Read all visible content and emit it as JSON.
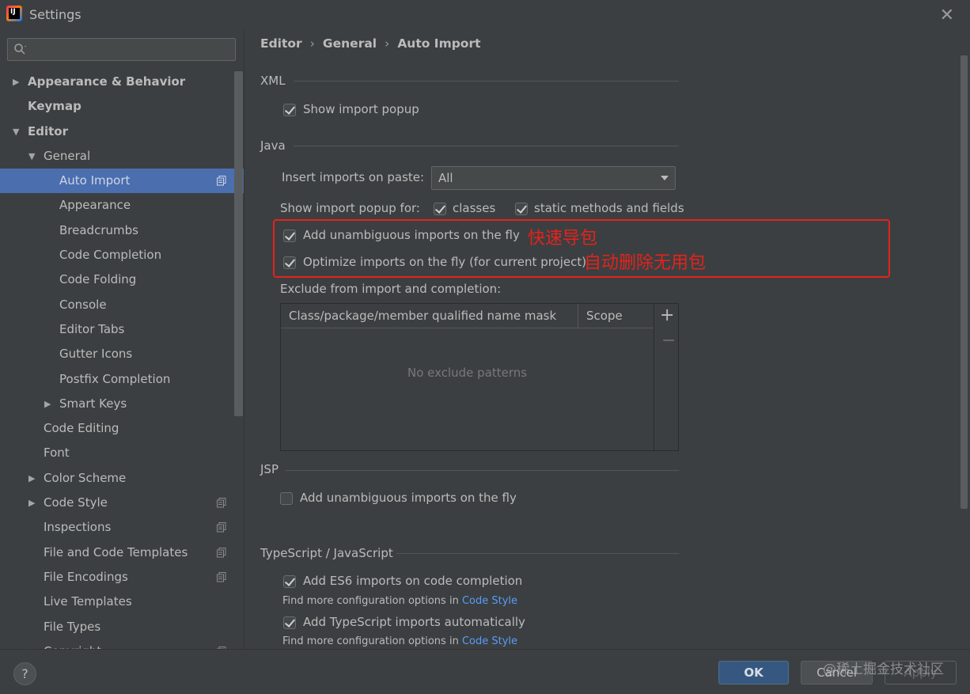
{
  "window": {
    "title": "Settings"
  },
  "search": {
    "placeholder": ""
  },
  "sidebar": {
    "items": [
      {
        "label": "Appearance & Behavior",
        "depth": 0,
        "bold": true,
        "arrow": "right"
      },
      {
        "label": "Keymap",
        "depth": 0,
        "bold": true,
        "arrow": ""
      },
      {
        "label": "Editor",
        "depth": 0,
        "bold": true,
        "arrow": "down"
      },
      {
        "label": "General",
        "depth": 1,
        "bold": false,
        "arrow": "down"
      },
      {
        "label": "Auto Import",
        "depth": 2,
        "bold": false,
        "arrow": "",
        "selected": true,
        "copy": true
      },
      {
        "label": "Appearance",
        "depth": 2,
        "bold": false,
        "arrow": ""
      },
      {
        "label": "Breadcrumbs",
        "depth": 2,
        "bold": false,
        "arrow": ""
      },
      {
        "label": "Code Completion",
        "depth": 2,
        "bold": false,
        "arrow": ""
      },
      {
        "label": "Code Folding",
        "depth": 2,
        "bold": false,
        "arrow": ""
      },
      {
        "label": "Console",
        "depth": 2,
        "bold": false,
        "arrow": ""
      },
      {
        "label": "Editor Tabs",
        "depth": 2,
        "bold": false,
        "arrow": ""
      },
      {
        "label": "Gutter Icons",
        "depth": 2,
        "bold": false,
        "arrow": ""
      },
      {
        "label": "Postfix Completion",
        "depth": 2,
        "bold": false,
        "arrow": ""
      },
      {
        "label": "Smart Keys",
        "depth": 2,
        "bold": false,
        "arrow": "right"
      },
      {
        "label": "Code Editing",
        "depth": 1,
        "bold": false,
        "arrow": ""
      },
      {
        "label": "Font",
        "depth": 1,
        "bold": false,
        "arrow": ""
      },
      {
        "label": "Color Scheme",
        "depth": 1,
        "bold": false,
        "arrow": "right"
      },
      {
        "label": "Code Style",
        "depth": 1,
        "bold": false,
        "arrow": "right",
        "copy": true
      },
      {
        "label": "Inspections",
        "depth": 1,
        "bold": false,
        "arrow": "",
        "copy": true
      },
      {
        "label": "File and Code Templates",
        "depth": 1,
        "bold": false,
        "arrow": "",
        "copy": true
      },
      {
        "label": "File Encodings",
        "depth": 1,
        "bold": false,
        "arrow": "",
        "copy": true
      },
      {
        "label": "Live Templates",
        "depth": 1,
        "bold": false,
        "arrow": ""
      },
      {
        "label": "File Types",
        "depth": 1,
        "bold": false,
        "arrow": ""
      },
      {
        "label": "Copyright",
        "depth": 1,
        "bold": false,
        "arrow": "right",
        "copy": true
      }
    ]
  },
  "breadcrumb": {
    "part1": "Editor",
    "part2": "General",
    "part3": "Auto Import",
    "sep": "›"
  },
  "xml": {
    "title": "XML",
    "show_import_popup": {
      "label": "Show import popup",
      "checked": true
    }
  },
  "java": {
    "title": "Java",
    "insert_imports_label": "Insert imports on paste:",
    "insert_imports_value": "All",
    "show_popup_for_label": "Show import popup for:",
    "classes": {
      "label": "classes",
      "checked": true
    },
    "static_methods": {
      "label": "static methods and fields",
      "checked": true
    },
    "add_unambiguous": {
      "label": "Add unambiguous imports on the fly",
      "checked": true
    },
    "optimize_imports": {
      "label": "Optimize imports on the fly (for current project)",
      "checked": true
    },
    "exclude_label": "Exclude from import and completion:",
    "table": {
      "columns": [
        "Class/package/member qualified name mask",
        "Scope"
      ],
      "empty_text": "No exclude patterns",
      "add_symbol": "+",
      "remove_symbol": "−"
    }
  },
  "annotations": {
    "quick_import": "快速导包",
    "auto_remove": "自动删除无用包",
    "color": "#e5221c"
  },
  "jsp": {
    "title": "JSP",
    "add_unambiguous": {
      "label": "Add unambiguous imports on the fly",
      "checked": false
    }
  },
  "ts": {
    "title": "TypeScript / JavaScript",
    "es6": {
      "label": "Add ES6 imports on code completion",
      "checked": true
    },
    "hint1_prefix": "Find more configuration options in",
    "hint1_link": "Code Style",
    "ts_imports": {
      "label": "Add TypeScript imports automatically",
      "checked": true
    },
    "hint2_prefix": "Find more configuration options in",
    "hint2_link": "Code Style"
  },
  "footer": {
    "help": "?",
    "ok": "OK",
    "cancel": "Cancel",
    "apply": "Apply",
    "watermark": "@稀土掘金技术社区"
  },
  "icons": {
    "app": "intellij-logo-icon",
    "close": "close-icon",
    "search": "search-icon",
    "copy": "copy-settings-icon"
  },
  "colors": {
    "selection": "#4b6eaf",
    "link": "#589df6",
    "ok_button": "#365880"
  }
}
